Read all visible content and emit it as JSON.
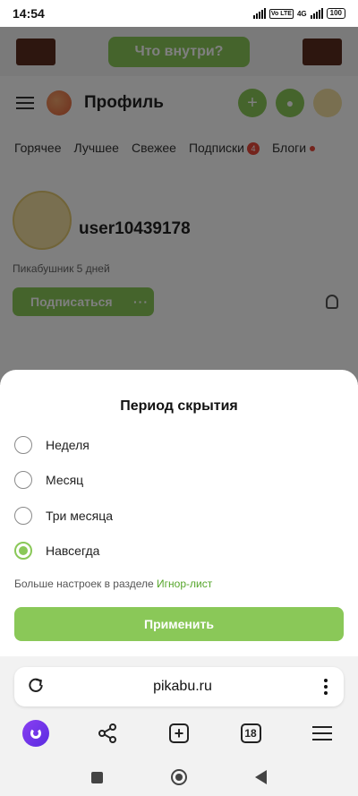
{
  "status_bar": {
    "time": "14:54",
    "volte": "Vo LTE",
    "network": "4G",
    "battery": "100"
  },
  "banner": {
    "cta_label": "Что внутри?"
  },
  "nav": {
    "title": "Профиль"
  },
  "tabs": [
    {
      "label": "Горячее"
    },
    {
      "label": "Лучшее"
    },
    {
      "label": "Свежее"
    },
    {
      "label": "Подписки",
      "badge": "4"
    },
    {
      "label": "Блоги"
    }
  ],
  "profile": {
    "username": "user10439178",
    "since": "Пикабушник 5 дней",
    "subscribe_label": "Подписаться",
    "more_label": "···"
  },
  "sheet": {
    "title": "Период скрытия",
    "options": [
      {
        "label": "Неделя",
        "selected": false
      },
      {
        "label": "Месяц",
        "selected": false
      },
      {
        "label": "Три месяца",
        "selected": false
      },
      {
        "label": "Навсегда",
        "selected": true
      }
    ],
    "hint_text": "Больше настроек в разделе ",
    "hint_link": "Игнор-лист",
    "apply_label": "Применить"
  },
  "browser": {
    "url": "pikabu.ru",
    "tab_count": "18"
  },
  "colors": {
    "accent": "#8ac858",
    "link": "#56a62b",
    "badge": "#e8483a"
  }
}
